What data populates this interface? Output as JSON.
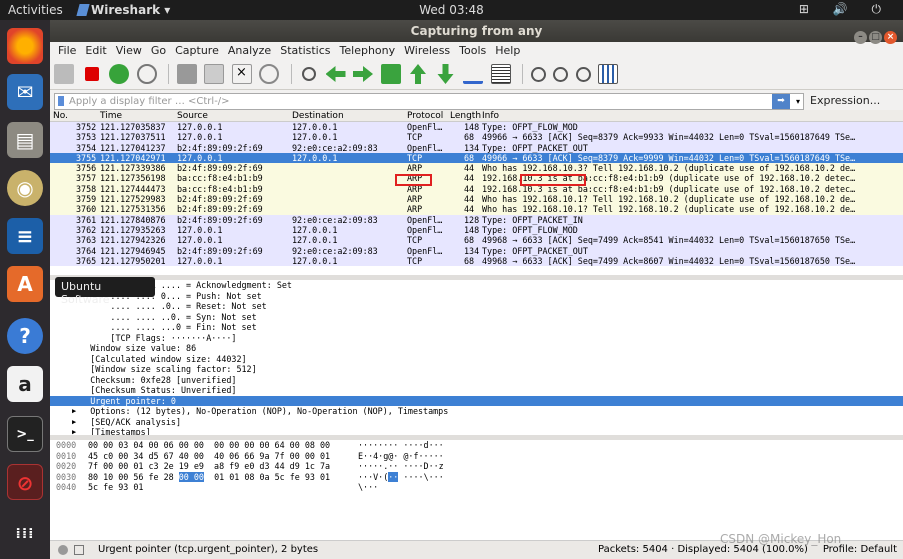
{
  "topbar": {
    "activities": "Activities",
    "app": "Wireshark",
    "clock": "Wed 03:48",
    "tray": "⊞ 🔊 ⏻"
  },
  "dock_tooltip": "Ubuntu Software",
  "window": {
    "title": "Capturing from any"
  },
  "menu": [
    "File",
    "Edit",
    "View",
    "Go",
    "Capture",
    "Analyze",
    "Statistics",
    "Telephony",
    "Wireless",
    "Tools",
    "Help"
  ],
  "filter": {
    "placeholder": "Apply a display filter … <Ctrl-/>",
    "arrow": "➡",
    "expression": "Expression..."
  },
  "columns": [
    "No.",
    "Time",
    "Source",
    "Destination",
    "Protocol",
    "Length",
    "Info"
  ],
  "packets": [
    {
      "no": "3752",
      "time": "121.127035837",
      "src": "127.0.0.1",
      "dst": "127.0.0.1",
      "proto": "OpenFl…",
      "len": "148",
      "info": "Type: OFPT_FLOW_MOD",
      "cls": "r-of"
    },
    {
      "no": "3753",
      "time": "121.127037511",
      "src": "127.0.0.1",
      "dst": "127.0.0.1",
      "proto": "TCP",
      "len": "68",
      "info": "49966 → 6633 [ACK] Seq=8379 Ack=9933 Win=44032 Len=0 TSval=1560187649 TSe…",
      "cls": "r-tcp"
    },
    {
      "no": "3754",
      "time": "121.127041237",
      "src": "b2:4f:89:09:2f:69",
      "dst": "92:e0:ce:a2:09:83",
      "proto": "OpenFl…",
      "len": "134",
      "info": "Type: OFPT_PACKET_OUT",
      "cls": "r-of"
    },
    {
      "no": "3755",
      "time": "121.127042971",
      "src": "127.0.0.1",
      "dst": "127.0.0.1",
      "proto": "TCP",
      "len": "68",
      "info": "49966 → 6633 [ACK] Seq=8379 Ack=9999 Win=44032 Len=0 TSval=1560187649 TSe…",
      "cls": "r-sel"
    },
    {
      "no": "3756",
      "time": "121.127339386",
      "src": "b2:4f:89:09:2f:69",
      "dst": "",
      "proto": "ARP",
      "len": "44",
      "info": "Who has 192.168.10.3? Tell 192.168.10.2 (duplicate use of 192.168.10.2 de…",
      "cls": "r-arp"
    },
    {
      "no": "3757",
      "time": "121.127356198",
      "src": "ba:cc:f8:e4:b1:b9",
      "dst": "",
      "proto": "ARP",
      "len": "44",
      "info": "192.168.10.3 is at ba:cc:f8:e4:b1:b9 (duplicate use of 192.168.10.2 detec…",
      "cls": "r-arp"
    },
    {
      "no": "3758",
      "time": "121.127444473",
      "src": "ba:cc:f8:e4:b1:b9",
      "dst": "",
      "proto": "ARP",
      "len": "44",
      "info": "192.168.10.3 is at ba:cc:f8:e4:b1:b9 (duplicate use of 192.168.10.2 detec…",
      "cls": "r-arp"
    },
    {
      "no": "3759",
      "time": "121.127529983",
      "src": "b2:4f:89:09:2f:69",
      "dst": "",
      "proto": "ARP",
      "len": "44",
      "info": "Who has 192.168.10.1? Tell 192.168.10.2 (duplicate use of 192.168.10.2 de…",
      "cls": "r-arp"
    },
    {
      "no": "3760",
      "time": "121.127531356",
      "src": "b2:4f:89:09:2f:69",
      "dst": "",
      "proto": "ARP",
      "len": "44",
      "info": "Who has 192.168.10.1? Tell 192.168.10.2 (duplicate use of 192.168.10.2 de…",
      "cls": "r-arp"
    },
    {
      "no": "3761",
      "time": "121.127840876",
      "src": "b2:4f:89:09:2f:69",
      "dst": "92:e0:ce:a2:09:83",
      "proto": "OpenFl…",
      "len": "128",
      "info": "Type: OFPT_PACKET_IN",
      "cls": "r-of"
    },
    {
      "no": "3762",
      "time": "121.127935263",
      "src": "127.0.0.1",
      "dst": "127.0.0.1",
      "proto": "OpenFl…",
      "len": "148",
      "info": "Type: OFPT_FLOW_MOD",
      "cls": "r-of"
    },
    {
      "no": "3763",
      "time": "121.127942326",
      "src": "127.0.0.1",
      "dst": "127.0.0.1",
      "proto": "TCP",
      "len": "68",
      "info": "49968 → 6633 [ACK] Seq=7499 Ack=8541 Win=44032 Len=0 TSval=1560187650 TSe…",
      "cls": "r-tcp"
    },
    {
      "no": "3764",
      "time": "121.127946945",
      "src": "b2:4f:89:09:2f:69",
      "dst": "92:e0:ce:a2:09:83",
      "proto": "OpenFl…",
      "len": "134",
      "info": "Type: OFPT_PACKET_OUT",
      "cls": "r-of"
    },
    {
      "no": "3765",
      "time": "121.127950201",
      "src": "127.0.0.1",
      "dst": "127.0.0.1",
      "proto": "TCP",
      "len": "68",
      "info": "49968 → 6633 [ACK] Seq=7499 Ack=8607 Win=44032 Len=0 TSval=1560187650 TSe…",
      "cls": "r-tcp"
    }
  ],
  "details": [
    {
      "t": "          .... ...1 .... = Acknowledgment: Set",
      "sel": false,
      "tri": ""
    },
    {
      "t": "          .... .... 0... = Push: Not set",
      "sel": false,
      "tri": ""
    },
    {
      "t": "          .... .... .0.. = Reset: Not set",
      "sel": false,
      "tri": ""
    },
    {
      "t": "          .... .... ..0. = Syn: Not set",
      "sel": false,
      "tri": ""
    },
    {
      "t": "          .... .... ...0 = Fin: Not set",
      "sel": false,
      "tri": ""
    },
    {
      "t": "          [TCP Flags: ·······A····]",
      "sel": false,
      "tri": ""
    },
    {
      "t": "      Window size value: 86",
      "sel": false,
      "tri": ""
    },
    {
      "t": "      [Calculated window size: 44032]",
      "sel": false,
      "tri": ""
    },
    {
      "t": "      [Window size scaling factor: 512]",
      "sel": false,
      "tri": ""
    },
    {
      "t": "      Checksum: 0xfe28 [unverified]",
      "sel": false,
      "tri": ""
    },
    {
      "t": "      [Checksum Status: Unverified]",
      "sel": false,
      "tri": ""
    },
    {
      "t": "      Urgent pointer: 0",
      "sel": true,
      "tri": ""
    },
    {
      "t": "      Options: (12 bytes), No-Operation (NOP), No-Operation (NOP), Timestamps",
      "sel": false,
      "tri": "▶"
    },
    {
      "t": "      [SEQ/ACK analysis]",
      "sel": false,
      "tri": "▶"
    },
    {
      "t": "      [Timestamps]",
      "sel": false,
      "tri": "▶"
    }
  ],
  "bytes": [
    {
      "off": "0000",
      "pre": "00 00 03 04 00 06 00 00  00 00 00 00 64 00 08 00",
      "hl": "",
      "post": "",
      "apre": "········ ····d···",
      "ahl": "",
      "apost": ""
    },
    {
      "off": "0010",
      "pre": "45 c0 00 34 d5 67 40 00  40 06 66 9a 7f 00 00 01",
      "hl": "",
      "post": "",
      "apre": "E··4·g@· @·f·····",
      "ahl": "",
      "apost": ""
    },
    {
      "off": "0020",
      "pre": "7f 00 00 01 c3 2e 19 e9  a8 f9 e0 d3 44 d9 1c 7a",
      "hl": "",
      "post": "",
      "apre": "·····.·· ····D··z",
      "ahl": "",
      "apost": ""
    },
    {
      "off": "0030",
      "pre": "80 10 00 56 fe 28 ",
      "hl": "00 00",
      "post": "  01 01 08 0a 5c fe 93 01",
      "apre": "···V·(",
      "ahl": "··",
      "apost": " ····\\···"
    },
    {
      "off": "0040",
      "pre": "5c fe 93 01",
      "hl": "",
      "post": "",
      "apre": "\\···",
      "ahl": "",
      "apost": ""
    }
  ],
  "status": {
    "msg": "Urgent pointer (tcp.urgent_pointer), 2 bytes",
    "packets": "Packets: 5404 · Displayed: 5404 (100.0%)",
    "profile": "Profile: Default"
  },
  "watermark": "CSDN @Mickey_Hon"
}
